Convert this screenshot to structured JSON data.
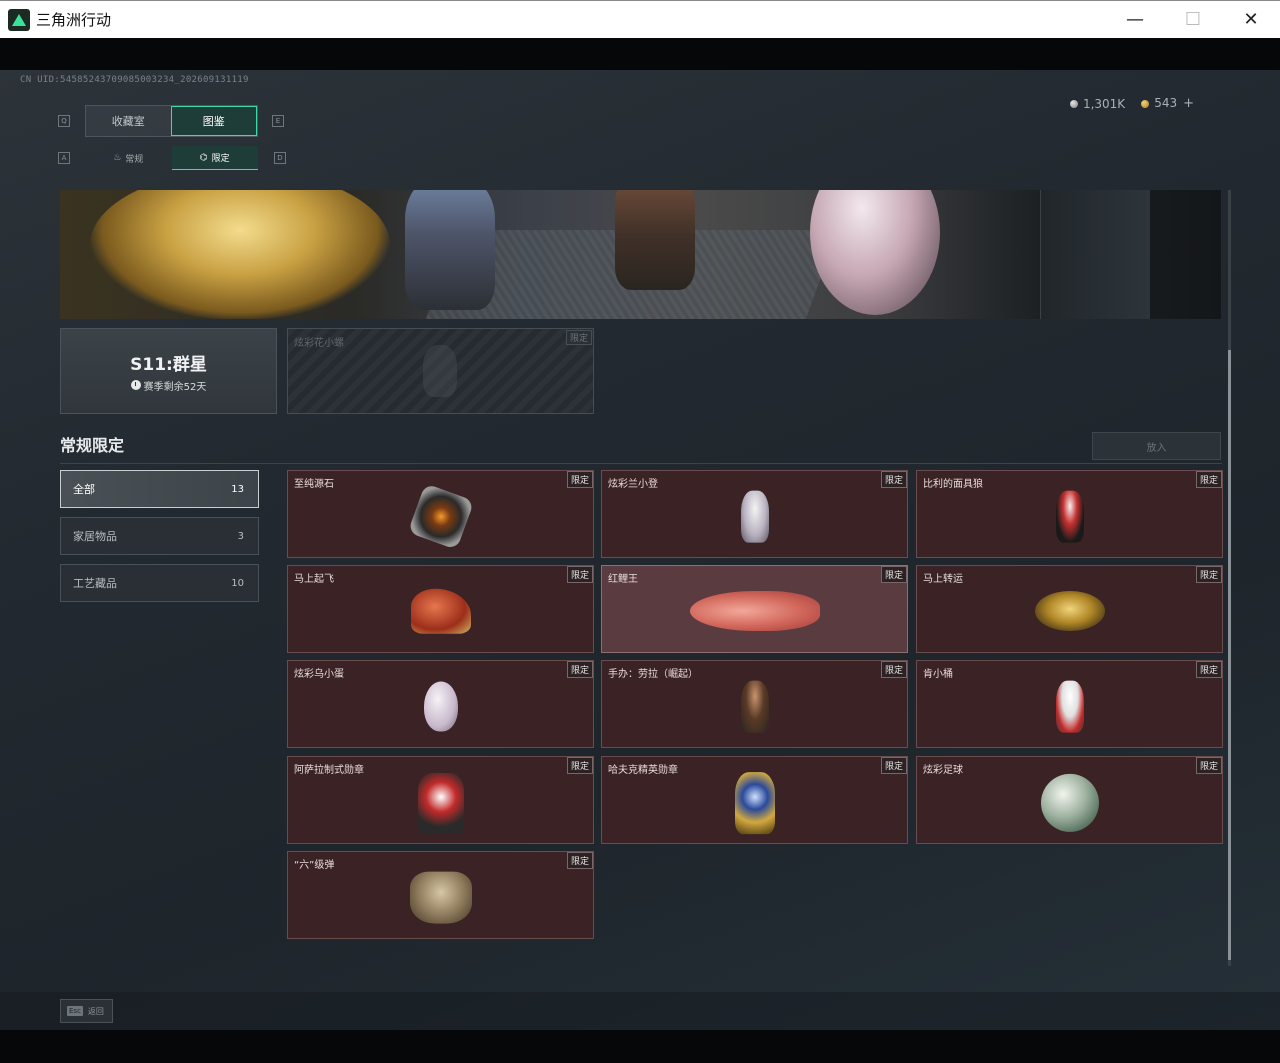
{
  "window": {
    "title": "三角洲行动",
    "minimize": "—",
    "maximize": "☐",
    "close": "✕"
  },
  "header": {
    "uid": "CN UID:54585243709085003234_202609131119",
    "silver_amount": "1,301K",
    "gold_amount": "543",
    "plus": "+"
  },
  "tabs": {
    "key_left": "Q",
    "key_right": "E",
    "items": [
      {
        "label": "收藏室",
        "active": false
      },
      {
        "label": "图鉴",
        "active": true
      }
    ]
  },
  "subtabs": {
    "key_left": "A",
    "key_right": "D",
    "items": [
      {
        "label": "常规",
        "icon": "♨",
        "active": false
      },
      {
        "label": "限定",
        "icon": "⌬",
        "active": true
      }
    ]
  },
  "season": {
    "name": "S11:群星",
    "remaining": "赛季剩余52天"
  },
  "featured": {
    "name": "炫彩花小螺",
    "badge": "限定"
  },
  "section": {
    "title": "常规限定",
    "put_button": "放入"
  },
  "filters": [
    {
      "label": "全部",
      "count": "13",
      "active": true
    },
    {
      "label": "家居物品",
      "count": "3",
      "active": false
    },
    {
      "label": "工艺藏品",
      "count": "10",
      "active": false
    }
  ],
  "items": [
    {
      "name": "至纯源石",
      "badge": "限定",
      "art": "stone"
    },
    {
      "name": "炫彩兰小登",
      "badge": "限定",
      "art": "fig-white"
    },
    {
      "name": "比利的面具狼",
      "badge": "限定",
      "art": "fig-mask"
    },
    {
      "name": "马上起飞",
      "badge": "限定",
      "art": "horse"
    },
    {
      "name": "红鲤王",
      "badge": "限定",
      "art": "fish"
    },
    {
      "name": "马上转运",
      "badge": "限定",
      "art": "compass"
    },
    {
      "name": "炫彩乌小蛋",
      "badge": "限定",
      "art": "egg"
    },
    {
      "name": "手办：劳拉（崛起）",
      "badge": "限定",
      "art": "fig-lara"
    },
    {
      "name": "肯小桶",
      "badge": "限定",
      "art": "fig-ken"
    },
    {
      "name": "阿萨拉制式勋章",
      "badge": "限定",
      "art": "medal-red"
    },
    {
      "name": "哈夫克精英勋章",
      "badge": "限定",
      "art": "medal-gold"
    },
    {
      "name": "炫彩足球",
      "badge": "限定",
      "art": "ball"
    },
    {
      "name": "“六”级弹",
      "badge": "限定",
      "art": "glove"
    }
  ],
  "footer": {
    "esc_key": "Esc",
    "back_label": "返回"
  },
  "colors": {
    "accent": "#3fd8a6",
    "card_bg": "#3b2325",
    "card_border": "#6a4b4e"
  }
}
